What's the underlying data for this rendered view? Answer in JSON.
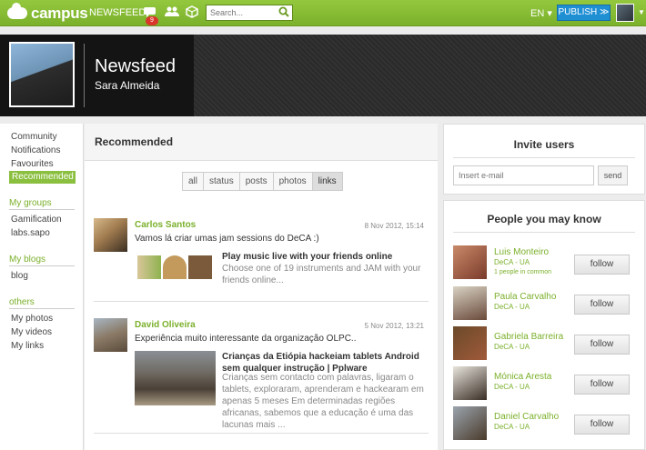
{
  "topbar": {
    "brand": "campus",
    "newsfeed_label": "NEWSFEED",
    "notification_count": "9",
    "search_placeholder": "Search...",
    "language": "EN ▾",
    "publish_label": "PUBLISH ≫"
  },
  "banner": {
    "title": "Newsfeed",
    "subtitle": "Sara Almeida"
  },
  "leftnav": {
    "items": [
      "Community",
      "Notifications",
      "Favourites",
      "Recommended"
    ],
    "groups_heading": "My groups",
    "groups": [
      "Gamification",
      "labs.sapo"
    ],
    "blogs_heading": "My blogs",
    "blogs": [
      "blog"
    ],
    "others_heading": "others",
    "others": [
      "My photos",
      "My videos",
      "My links"
    ]
  },
  "main": {
    "title": "Recommended",
    "filters": [
      "all",
      "status",
      "posts",
      "photos",
      "links"
    ],
    "posts": [
      {
        "author": "Carlos Santos",
        "date": "8 Nov 2012, 15:14",
        "text": "Vamos lá criar umas jam sessions do DeCA :)",
        "link_title": "Play music live with your friends online",
        "link_desc": "Choose one of 19 instruments and JAM with your friends online..."
      },
      {
        "author": "David Oliveira",
        "date": "5 Nov 2012, 13:21",
        "text": "Experiência muito interessante da organização OLPC..",
        "link_title": "Crianças da Etiópia hackeiam tablets Android sem qualquer instrução | Pplware",
        "link_desc": "Crianças sem contacto com palavras, ligaram o tablets, exploraram, aprenderam e hackearam em apenas 5 meses Em determinadas regiões africanas, sabemos que a educação é uma das lacunas mais ..."
      }
    ]
  },
  "invite": {
    "title": "Invite users",
    "email_placeholder": "Insert e-mail",
    "send_label": "send"
  },
  "people": {
    "title": "People you may know",
    "follow_label": "follow",
    "list": [
      {
        "name": "Luis Monteiro",
        "org": "DeCA - UA",
        "common": "1 people in common"
      },
      {
        "name": "Paula Carvalho",
        "org": "DeCA - UA"
      },
      {
        "name": "Gabriela Barreira",
        "org": "DeCA - UA"
      },
      {
        "name": "Mónica Aresta",
        "org": "DeCA - UA"
      },
      {
        "name": "Daniel Carvalho",
        "org": "DeCA - UA"
      }
    ]
  }
}
